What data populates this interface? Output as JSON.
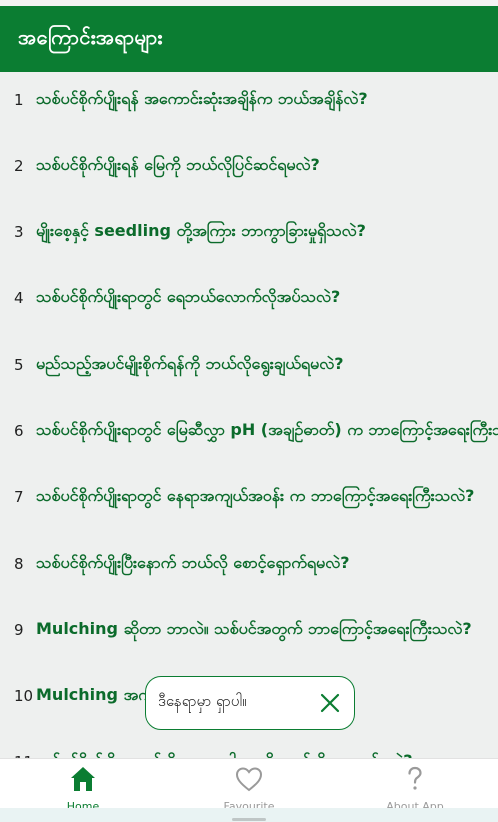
{
  "header": {
    "title": "အကြောင်းအရာများ"
  },
  "list": [
    {
      "num": "1",
      "q": "သစ်ပင်စိုက်ပျိုးရန် အကောင်းဆုံးအချိန်က ဘယ်အချိန်လဲ?"
    },
    {
      "num": "2",
      "q": "သစ်ပင်စိုက်ပျိုးရန် မြေကို ဘယ်လိုပြင်ဆင်ရမလဲ?"
    },
    {
      "num": "3",
      "q": "မျိုးစေ့နှင့် seedling တို့အကြား ဘာကွာခြားမှုရှိသလဲ?"
    },
    {
      "num": "4",
      "q": "သစ်ပင်စိုက်ပျိုးရာတွင် ရေဘယ်လောက်လိုအပ်သလဲ?"
    },
    {
      "num": "5",
      "q": "မည်သည့်အပင်မျိုးစိုက်ရန်ကို ဘယ်လိုရွေးချယ်ရမလဲ?"
    },
    {
      "num": "6",
      "q": "သစ်ပင်စိုက်ပျိုးရာတွင် မြေဆီလွှာ pH (အချဉ်ဓာတ်) က ဘာကြောင့်အရေးကြီးသလဲ?"
    },
    {
      "num": "7",
      "q": "သစ်ပင်စိုက်ပျိုးရာတွင် နေရာအကျယ်အဝန်း က ဘာကြောင့်အရေးကြီးသလဲ?"
    },
    {
      "num": "8",
      "q": "သစ်ပင်စိုက်ပျိုးပြီးနောက် ဘယ်လို စောင့်ရှောက်ရမလဲ?"
    },
    {
      "num": "9",
      "q": "Mulching ဆိုတာ ဘာလဲ။ သစ်ပင်အတွက် ဘာကြောင့်အရေးကြီးသလဲ?"
    },
    {
      "num": "10",
      "q": "Mulching အကျိုးကျေးဇူးများ ဘာတွေလဲ?"
    },
    {
      "num": "11",
      "q": "သစ်ပင်စိုက်ပျိုးရာတွင် ပိုးမွှားရောဂါများကို ဘယ်လိုကာကွယ်မလဲ?"
    }
  ],
  "toast": {
    "message": "ဒီနေရာမှာ ရှာပါ။"
  },
  "nav": [
    {
      "label": "Home",
      "icon": "home-icon"
    },
    {
      "label": "Favourite",
      "icon": "heart-icon"
    },
    {
      "label": "About App",
      "icon": "question-icon"
    }
  ],
  "colors": {
    "primary": "#0b7d32",
    "question_text": "#0b6b2b",
    "inactive": "#9a9a9a"
  }
}
